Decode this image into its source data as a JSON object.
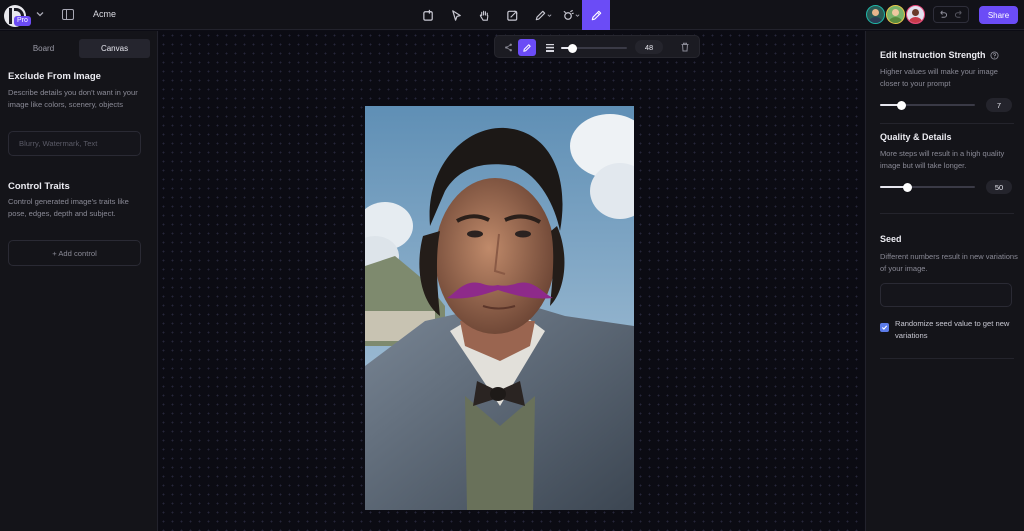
{
  "header": {
    "workspace_name": "Acme",
    "badge": "Pro",
    "share_label": "Share"
  },
  "icons": {
    "tools": [
      "frame-icon",
      "pointer-icon",
      "hand-icon",
      "image-edit-icon",
      "pen-icon",
      "brush-effects-icon",
      "inpaint-pen-icon"
    ],
    "active_tool": "inpaint-pen-icon"
  },
  "left_panel": {
    "tabs": [
      {
        "label": "Board",
        "active": false
      },
      {
        "label": "Canvas",
        "active": true
      }
    ],
    "exclude": {
      "title": "Exclude From Image",
      "description": "Describe details you don't want in your image like colors, scenery, objects",
      "placeholder": "Blurry, Watermark, Text",
      "value": ""
    },
    "control": {
      "title": "Control Traits",
      "description": "Control generated image's traits like pose, edges, depth and subject.",
      "add_label": "+ Add control"
    }
  },
  "brush_toolbar": {
    "size_value": "48",
    "size_fraction": 0.18
  },
  "right_panel": {
    "strength": {
      "title": "Edit Instruction Strength",
      "description": "Higher values will make your image closer to your prompt",
      "value": "7",
      "fraction": 0.23
    },
    "quality": {
      "title": "Quality & Details",
      "description": "More steps will result in a high quality image but will take longer.",
      "value": "50",
      "fraction": 0.29
    },
    "seed": {
      "title": "Seed",
      "description": "Different numbers result in new variations of your image.",
      "value": "",
      "randomize_label": "Randomize seed value to get new variations",
      "randomize_checked": true
    }
  },
  "colors": {
    "accent": "#6b4cf6",
    "checkbox": "#5b7be8",
    "avatars": [
      "#1fb5a6",
      "#e8c64a",
      "#e8467a"
    ]
  }
}
